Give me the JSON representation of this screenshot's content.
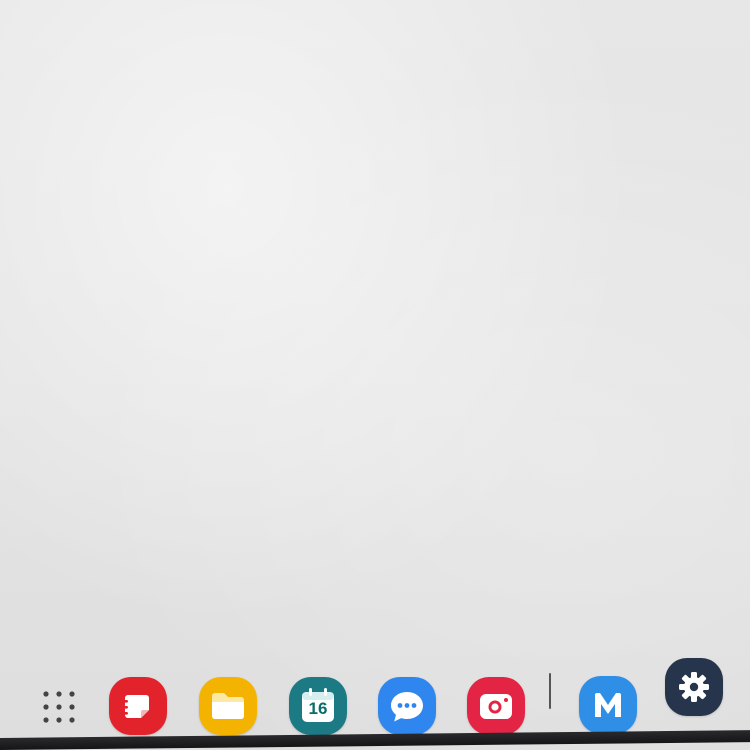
{
  "taskbar": {
    "launcher": {
      "icon": "app-grid-icon"
    },
    "apps": [
      {
        "name": "notes",
        "icon": "notes-icon",
        "color": "#e5252b"
      },
      {
        "name": "files",
        "icon": "folder-icon",
        "color": "#f4b400"
      },
      {
        "name": "calendar",
        "icon": "calendar-icon",
        "color": "#1e7d86",
        "day": "16"
      },
      {
        "name": "messages",
        "icon": "chat-bubble-icon",
        "color": "#2d86f0"
      },
      {
        "name": "camera",
        "icon": "camera-icon",
        "color": "#e62545"
      },
      {
        "name": "m-app",
        "icon": "m-logo-icon",
        "color": "#2f8fe6"
      },
      {
        "name": "settings",
        "icon": "gear-icon",
        "color": "#2a3a52"
      }
    ]
  }
}
